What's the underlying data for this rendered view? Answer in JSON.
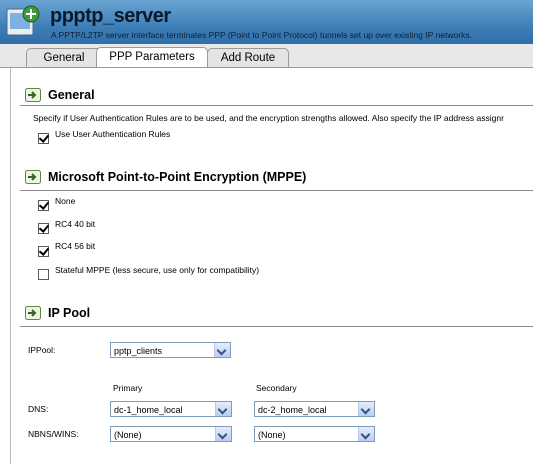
{
  "header": {
    "title": "ppptp_server",
    "subtitle": "A PPTP/L2TP server interface terminates PPP (Point to Point Protocol) tunnels set up over existing IP networks."
  },
  "tabs": [
    {
      "label": "General",
      "active": false
    },
    {
      "label": "PPP Parameters",
      "active": true
    },
    {
      "label": "Add Route",
      "active": false
    }
  ],
  "sections": {
    "general": {
      "title": "General",
      "description": "Specify if User Authentication Rules are to be used, and the encryption strengths allowed. Also specify the IP address assignr",
      "use_auth_rules": {
        "label": "Use User Authentication Rules",
        "checked": true
      }
    },
    "mppe": {
      "title": "Microsoft Point-to-Point Encryption (MPPE)",
      "options": [
        {
          "label": "None",
          "checked": true
        },
        {
          "label": "RC4 40 bit",
          "checked": true
        },
        {
          "label": "RC4 56 bit",
          "checked": true
        },
        {
          "label": "Stateful MPPE (less secure, use only for compatibility)",
          "checked": false
        }
      ]
    },
    "ippool": {
      "title": "IP Pool",
      "ippool_label": "IPPool:",
      "ippool_value": "pptp_clients",
      "primary_label": "Primary",
      "secondary_label": "Secondary",
      "dns_label": "DNS:",
      "dns_primary": "dc-1_home_local",
      "dns_secondary": "dc-2_home_local",
      "nbns_label": "NBNS/WINS:",
      "nbns_primary": "(None)",
      "nbns_secondary": "(None)"
    }
  },
  "colors": {
    "header_blue": "#3f7fb8",
    "section_rule": "#8a8a8a",
    "select_border": "#7f9db9"
  }
}
